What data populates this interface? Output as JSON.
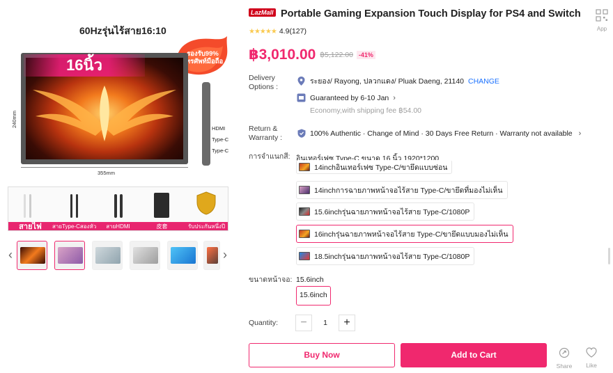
{
  "gallery": {
    "image_title": "60Hzรุ่นไร้สาย16:10",
    "promo_text_line1": "รองรับ99%",
    "promo_text_line2": "โทรศัพท์มือถือ",
    "size_badge": "16นิ้ว",
    "port_labels": [
      "HDMI",
      "Type-C",
      "Type-C"
    ],
    "dim_height": "240mm",
    "dim_width": "355mm",
    "accessories": [
      {
        "label": "สายไฟ"
      },
      {
        "label": "สายType-Cสองหัว"
      },
      {
        "label": "สายHDMI"
      },
      {
        "label": "皮套"
      },
      {
        "label": "รับประกันหนึ่งปี"
      }
    ],
    "prev_arrow": "‹",
    "next_arrow": "›"
  },
  "product": {
    "badge": "LazMall",
    "title": "Portable Gaming Expansion Touch Display for PS4 and Switch",
    "rating": "4.9",
    "reviews": "(127)",
    "price": "฿3,010.00",
    "original_price": "฿5,122.00",
    "discount": "-41%"
  },
  "app_qr": {
    "label": "App"
  },
  "delivery": {
    "label_line1": "Delivery",
    "label_line2": "Options :",
    "address": "ระยอง/ Rayong, ปลวกแดง/ Pluak Daeng, 21140",
    "change": "CHANGE",
    "guarantee": "Guaranteed by 6-10 Jan",
    "shipping": "Economy,with shipping fee ฿54.00"
  },
  "return": {
    "label_line1": "Return &",
    "label_line2": "Warranty :",
    "text": "100% Authentic · Change of Mind · 30 Days Free Return · Warranty not available"
  },
  "variants": {
    "label": "การจำแนกสี:",
    "selected_text": "อินเทอร์เฟซ Type-C ขนาด 16 นิ้ว 1920*1200",
    "options": [
      {
        "label": "14inchอินเทอร์เฟซ Type-C/ขายึดแบบซ่อน"
      },
      {
        "label": "14inchการฉายภาพหน้าจอไร้สาย Type-C/ขายึดที่มองไม่เห็น"
      },
      {
        "label": "15.6inchรุ่นฉายภาพหน้าจอไร้สาย Type-C/1080P"
      },
      {
        "label": "16inchรุ่นฉายภาพหน้าจอไร้สาย Type-C/ขายึดแบบมองไม่เห็น"
      },
      {
        "label": "18.5inchรุ่นฉายภาพหน้าจอไร้สาย Type-C/1080P"
      }
    ],
    "selected_index": 3
  },
  "screen_size": {
    "label": "ขนาดหน้าจอ:",
    "value": "15.6inch",
    "option": "15.6inch"
  },
  "quantity": {
    "label": "Quantity:",
    "value": "1",
    "minus": "−",
    "plus": "+"
  },
  "actions": {
    "buy_now": "Buy Now",
    "add_to_cart": "Add to Cart",
    "share": "Share",
    "like": "Like"
  },
  "colors": {
    "accent": "#f0286e",
    "link": "#1a71ff",
    "star": "#faca51",
    "lazmall": "#d0021b"
  }
}
